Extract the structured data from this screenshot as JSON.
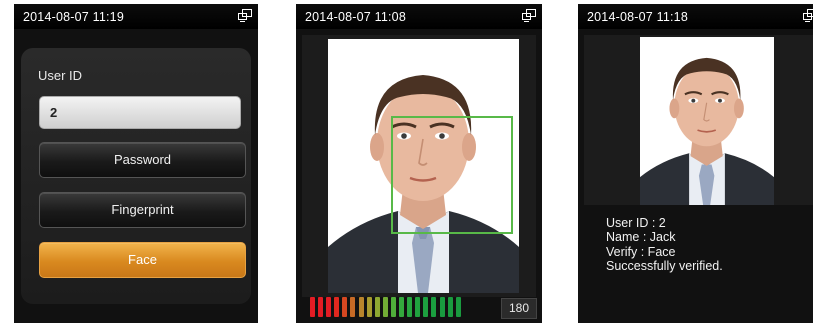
{
  "screens": [
    {
      "time": "2014-08-07 11:19"
    },
    {
      "time": "2014-08-07 11:08"
    },
    {
      "time": "2014-08-07 11:18"
    }
  ],
  "verify_menu": {
    "user_id_label": "User ID",
    "user_id_value": "2",
    "buttons": [
      "Password",
      "Fingerprint",
      "Face"
    ],
    "selected": "Face"
  },
  "face_capture": {
    "quality_score": "180",
    "meter_level": 1.0,
    "meter_colors": [
      "#e31c24",
      "#e31c24",
      "#e31c24",
      "#e0281f",
      "#d64721",
      "#c66a25",
      "#b8852c",
      "#a79c2f",
      "#8ea831",
      "#72ac35",
      "#4fae3a",
      "#34a83d",
      "#27a53f",
      "#20a23f",
      "#1da03f",
      "#1a9e3f",
      "#199c3f",
      "#1a9b3f",
      "#1a9a3f"
    ]
  },
  "result": {
    "lines": [
      "User ID : 2",
      "Name : Jack",
      "Verify : Face",
      "Successfully verified."
    ]
  },
  "icons": {
    "network": "network-icon"
  },
  "colors": {
    "accent": "#d9891f",
    "face_box": "#58b948"
  }
}
